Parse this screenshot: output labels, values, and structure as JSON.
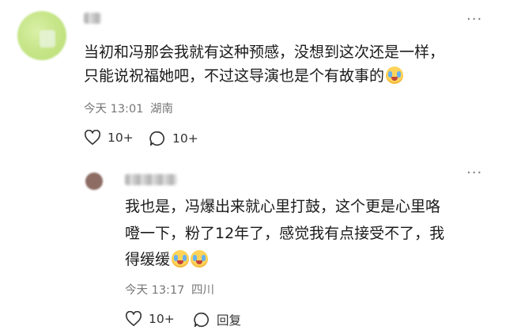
{
  "comment": {
    "text_line1": "当初和冯那会我就有这种预感，没想到这次还是一样，",
    "text_line2": "只能说祝福她吧，不过这导演也是个有故事的",
    "time": "今天 13:01",
    "location": "湖南",
    "like_count": "10+",
    "reply_count": "10+",
    "more_label": "···"
  },
  "reply": {
    "text_line1": "我也是，冯爆出来就心里打鼓，这个更是心里咯",
    "text_line2": "噔一下，粉了12年了，感觉我有点接受不了，我",
    "text_line3": "得缓缓",
    "time": "今天 13:17",
    "location": "四川",
    "like_count": "10+",
    "reply_label": "回复",
    "more_label": "···"
  },
  "icons": {
    "like": "heart-outline-icon",
    "comment": "speech-bubble-icon",
    "emoji": "crying-face-emoji-icon",
    "more": "more-dots-icon"
  }
}
